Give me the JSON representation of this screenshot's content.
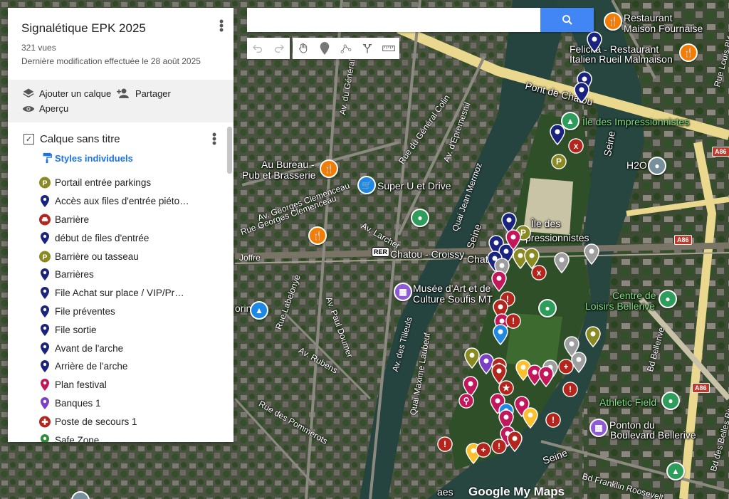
{
  "panel": {
    "title": "Signalétique EPK 2025",
    "views": "321 vues",
    "modified": "Dernière modification effectuée le 28 août 2025",
    "add_layer": "Ajouter un calque",
    "share": "Partager",
    "preview": "Aperçu",
    "layer_name": "Calque sans titre",
    "styles": "Styles individuels",
    "items": [
      {
        "label": "Portail entrée parkings",
        "icon": "parking-p-icon",
        "color": "#8a8a23"
      },
      {
        "label": "Accès aux files d'entrée piéto…",
        "icon": "pin-icon",
        "color": "#1a237e"
      },
      {
        "label": "Barrière",
        "icon": "car-icon",
        "color": "#b3261e"
      },
      {
        "label": "début de files d'entrée",
        "icon": "pin-icon",
        "color": "#1a237e"
      },
      {
        "label": "Barrière ou tasseau",
        "icon": "parking-p-icon",
        "color": "#8a8a23"
      },
      {
        "label": "Barrières",
        "icon": "pin-icon",
        "color": "#1a237e"
      },
      {
        "label": "File Achat sur place / VIP/Pr…",
        "icon": "pin-icon",
        "color": "#1a237e"
      },
      {
        "label": "File préventes",
        "icon": "pin-icon",
        "color": "#1a237e"
      },
      {
        "label": "File sortie",
        "icon": "pin-icon",
        "color": "#1a237e"
      },
      {
        "label": "Avant de l'arche",
        "icon": "pin-icon",
        "color": "#1a237e"
      },
      {
        "label": "Arrière de l'arche",
        "icon": "pin-icon",
        "color": "#1a237e"
      },
      {
        "label": "Plan festival",
        "icon": "pin-icon",
        "color": "#c2185b"
      },
      {
        "label": "Banques 1",
        "icon": "pin-icon",
        "color": "#7b3fc4"
      },
      {
        "label": "Poste de secours 1",
        "icon": "cross-icon",
        "color": "#b3261e"
      },
      {
        "label": "Safe Zone",
        "icon": "pin-icon",
        "color": "#2e8b3a"
      }
    ]
  },
  "search": {
    "placeholder": ""
  },
  "map_labels": {
    "restaurant": "Restaurant",
    "maison_fournaise": "Maison Fournaise",
    "felicita": "Felicità - Restaurant",
    "italien": "Italien Rueil Malmaison",
    "pont_chatou": "Pont de Chatou",
    "ile_impressionnistes": "Île des Impressionnistes",
    "ile_des": "Île des",
    "pressionnistes": "pressionnistes",
    "au_bureau": "Au Bureau -",
    "pub_brasserie": "Pub et Brasserie",
    "super_u": "Super U et Drive",
    "h2o": "H2O",
    "rer": "RER",
    "chatou_croissy": "Chatou - Croissy",
    "chat": "Chat",
    "musee1": "Musée d'Art et de",
    "musee2": "Culture Soufis MT",
    "centre1": "Centre de",
    "centre2": "Loisirs Bellerive",
    "athletic": "Athletic Field",
    "ponton1": "Ponton du",
    "ponton2": "Boulevard Bellerive",
    "seine": "Seine",
    "orin": "orin",
    "aes": "aes",
    "rue_general_colin": "Rue du Général Colin",
    "av_general": "Av. du Général",
    "av_epremesnil": "Av. d'Epremesnil",
    "quai_jean_mermoz": "Quai Jean Mermoz",
    "av_larcher": "Av. Larcher",
    "georges_clemenceau": "Av. Georges Clemenceau",
    "rue_georges": "Rue Georges Clemenceau",
    "joffre": "Joffre",
    "rue_labelonye": "Rue Labelonye",
    "av_paul_doumer": "Av. Paul Doumer",
    "av_tilleuls": "Av. des Tilleuls",
    "quai_maxime_laubeuf": "Quai Maxime Laubeuf",
    "av_rubens": "Av. Rubens",
    "rue_pommerots": "Rue des Pommerots",
    "bd_bellerive": "Bd Bellerive",
    "bd_franklin": "Bd Franklin Roosevelt",
    "rue_louis_bleriot": "Rue Louis Blériot",
    "bd_des_belles_rives": "Bd des Belles Rives",
    "a86": "A86"
  },
  "logo": "Google My Maps",
  "colors": {
    "accent": "#4285f4",
    "navy_pin": "#1a237e",
    "olive_pin": "#8a8a23",
    "red_pin": "#b3261e",
    "pink_pin": "#c2185b",
    "purple_pin": "#7b3fc4",
    "green_pin": "#2e8b3a"
  }
}
